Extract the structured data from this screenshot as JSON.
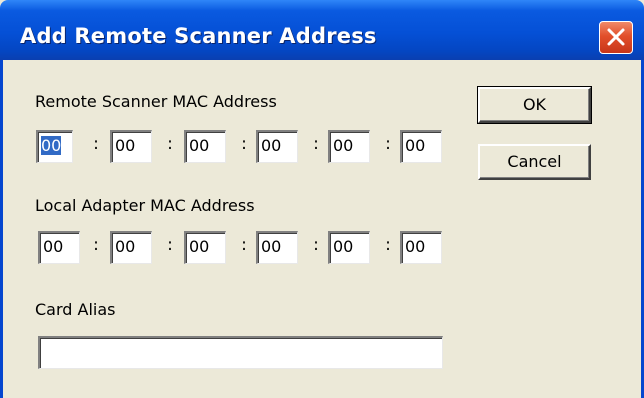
{
  "window": {
    "title": "Add Remote Scanner Address"
  },
  "remote": {
    "label": "Remote Scanner MAC Address",
    "octets": [
      "00",
      "00",
      "00",
      "00",
      "00",
      "00"
    ],
    "separator": ":"
  },
  "local": {
    "label": "Local Adapter MAC Address",
    "octets": [
      "00",
      "00",
      "00",
      "00",
      "00",
      "00"
    ],
    "separator": ":"
  },
  "alias": {
    "label": "Card Alias",
    "value": ""
  },
  "buttons": {
    "ok": "OK",
    "cancel": "Cancel"
  },
  "colors": {
    "titlebar": "#0550d6",
    "selection": "#316ac5",
    "close": "#e24f2a",
    "face": "#ece9d8"
  },
  "icons": {
    "close": "close-icon"
  }
}
